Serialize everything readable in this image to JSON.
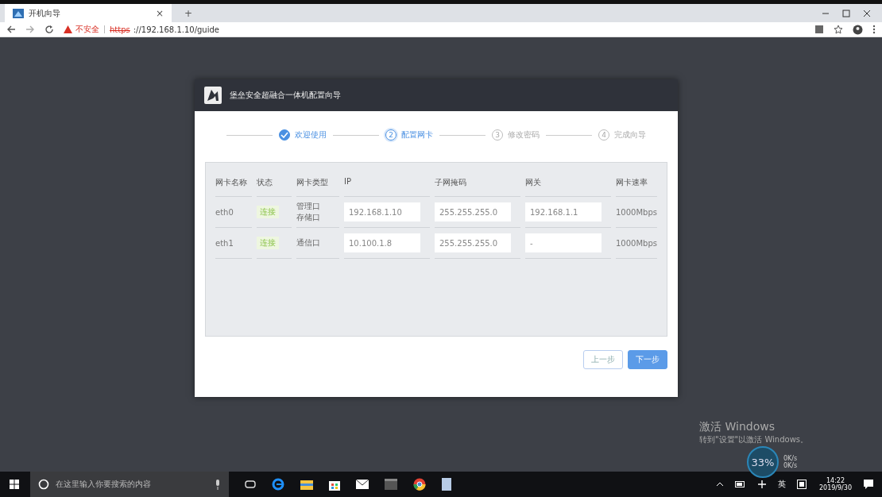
{
  "browser": {
    "tab": {
      "title": "开机向导",
      "close": "×"
    },
    "new_tab": "+",
    "address": {
      "warning": "不安全",
      "scheme": "https",
      "rest": "://192.168.1.10/guide"
    }
  },
  "dialog": {
    "title": "堡垒安全超融合一体机配置向导",
    "steps": [
      {
        "label": "欢迎使用",
        "completed": true,
        "selected": false
      },
      {
        "number": "2",
        "label": "配置网卡",
        "completed": false,
        "selected": true
      },
      {
        "number": "3",
        "label": "修改密码",
        "completed": false,
        "selected": false
      },
      {
        "number": "4",
        "label": "完成向导",
        "completed": false,
        "selected": false
      }
    ],
    "table": {
      "columns": [
        "网卡名称",
        "状态",
        "网卡类型",
        "IP",
        "子网掩码",
        "网关",
        "网卡速率"
      ],
      "rows": [
        {
          "name": "eth0",
          "status": "连接",
          "types": [
            "管理口",
            "存储口"
          ],
          "ip": "192.168.1.10",
          "mask": "255.255.255.0",
          "gateway": "192.168.1.1",
          "speed": "1000Mbps"
        },
        {
          "name": "eth1",
          "status": "连接",
          "types": [
            "通信口"
          ],
          "ip": "10.100.1.8",
          "mask": "255.255.255.0",
          "gateway": "-",
          "speed": "1000Mbps"
        }
      ]
    },
    "buttons": {
      "prev": "上一步",
      "next": "下一步"
    }
  },
  "activation": {
    "title": "激活 Windows",
    "subtitle": "转到\"设置\"以激活 Windows。"
  },
  "speed_widget": {
    "percent": "33%",
    "up": "0K/s",
    "down": "0K/s"
  },
  "taskbar": {
    "search_placeholder": "在这里输入你要搜索的内容",
    "ime": "英",
    "time": "14:22",
    "date": "2019/9/30"
  }
}
